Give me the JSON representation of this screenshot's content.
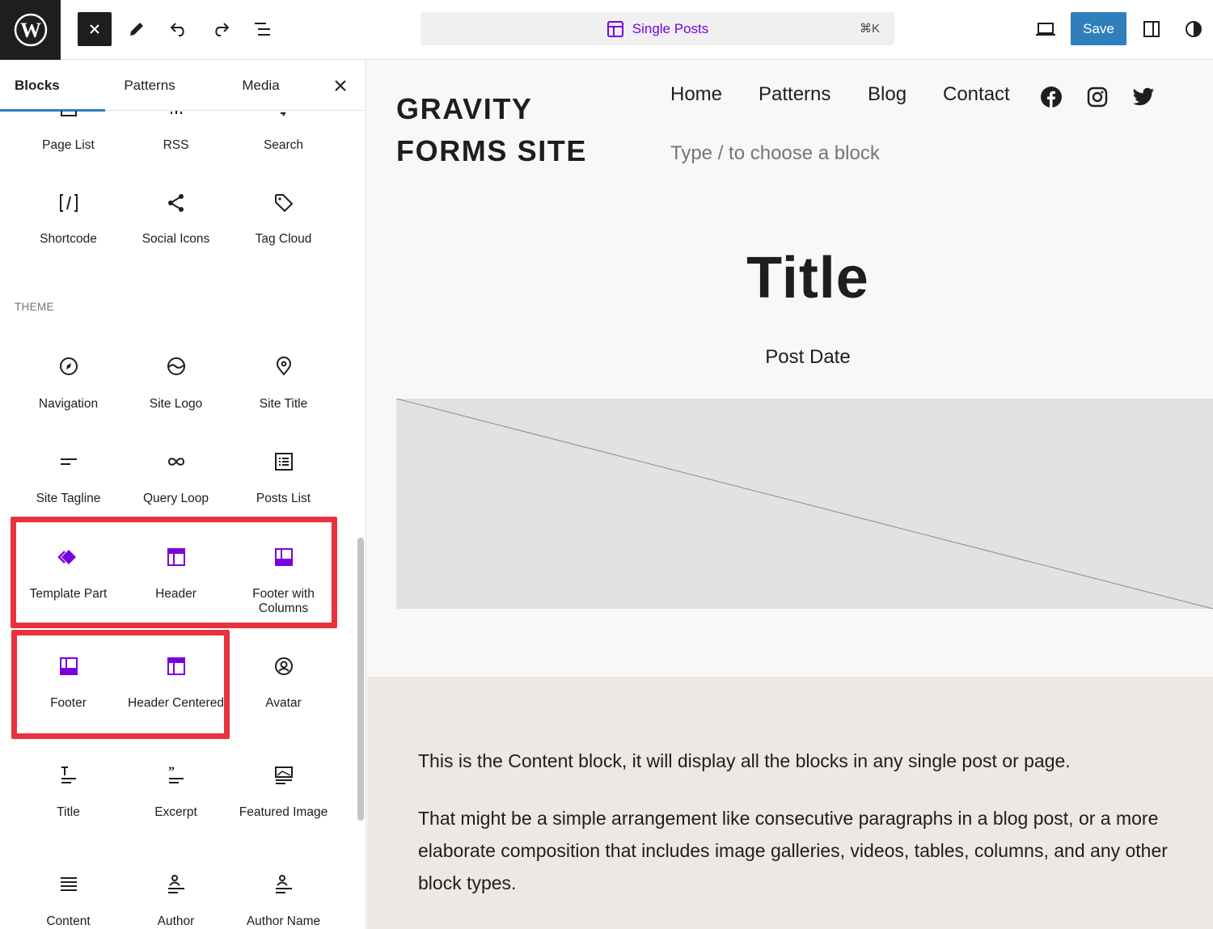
{
  "topbar": {
    "template_title": "Single Posts",
    "shortcut": "⌘K",
    "save_label": "Save"
  },
  "sidebar": {
    "tabs": [
      "Blocks",
      "Patterns",
      "Media"
    ],
    "partial_row": [
      "Page List",
      "RSS",
      "Search"
    ],
    "rows_top": [
      [
        "Shortcode",
        "Social Icons",
        "Tag Cloud"
      ]
    ],
    "theme_heading": "THEME",
    "theme_rows": [
      [
        "Navigation",
        "Site Logo",
        "Site Title"
      ],
      [
        "Site Tagline",
        "Query Loop",
        "Posts List"
      ],
      [
        "Template Part",
        "Header",
        "Footer with Columns"
      ],
      [
        "Footer",
        "Header Centered",
        "Avatar"
      ],
      [
        "Title",
        "Excerpt",
        "Featured Image"
      ],
      [
        "Content",
        "Author",
        "Author Name"
      ]
    ],
    "accent_color": "#7a00df",
    "highlight_color": "#e8323e"
  },
  "canvas": {
    "site_title": "GRAVITY FORMS SITE",
    "nav": [
      "Home",
      "Patterns",
      "Blog",
      "Contact"
    ],
    "social": [
      "facebook-icon",
      "instagram-icon",
      "twitter-icon"
    ],
    "placeholder": "Type / to choose a block",
    "post_title": "Title",
    "post_date": "Post Date",
    "content_paragraphs": [
      "This is the Content block, it will display all the blocks in any single post or page.",
      "That might be a simple arrangement like consecutive paragraphs in a blog post, or a more elaborate composition that includes image galleries, videos, tables, columns, and any other block types."
    ]
  }
}
